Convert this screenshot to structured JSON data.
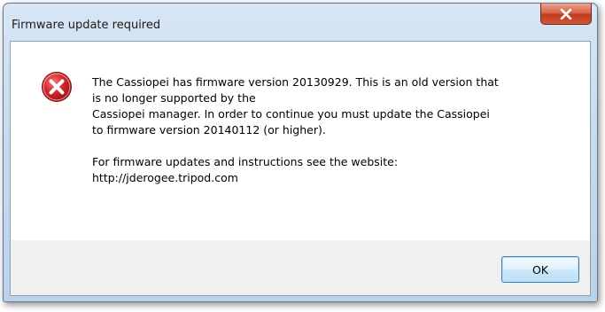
{
  "window": {
    "title": "Firmware update required",
    "close_icon": "close-x-icon"
  },
  "message": {
    "icon": "error-icon",
    "line1": "The Cassiopei has firmware version 20130929. This is an old version that\nis no longer supported by the\nCassiopei manager. In order to continue you must update the Cassiopei\nto firmware version 20140112 (or higher).",
    "line2": "For firmware updates and instructions see the website:\nhttp://jderogee.tripod.com"
  },
  "buttons": {
    "ok_label": "OK"
  },
  "colors": {
    "error_red": "#c8262a",
    "close_red": "#c13a1e",
    "focus_blue": "#3c7fb1"
  }
}
